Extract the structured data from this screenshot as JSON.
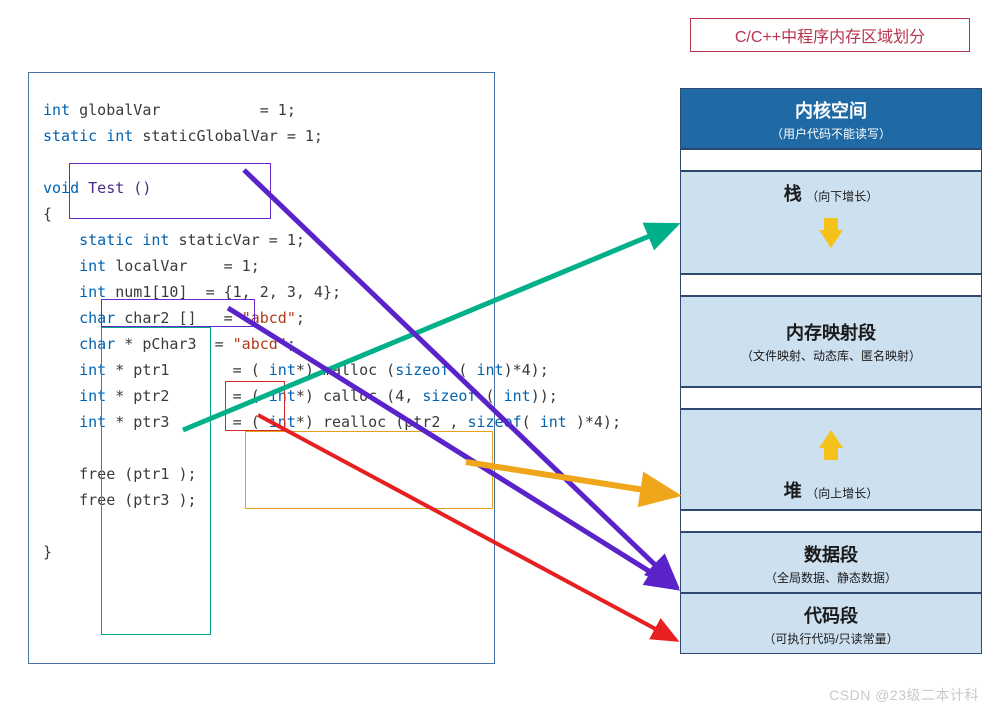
{
  "title": "C/C++中程序内存区域划分",
  "code": {
    "l1a": "int",
    "l1b": " globalVar",
    "l1c": "= 1;",
    "l2a": "static int",
    "l2b": " staticGlobalVar ",
    "l2c": "= 1;",
    "l4a": "void",
    "l4b": " Test ()",
    "l5": "{",
    "l6a": "static int",
    "l6b": " staticVar ",
    "l6c": "= 1;",
    "l7a": "int",
    "l7b": " localVar",
    "l7c": "= 1;",
    "l8a": "int",
    "l8b": " num1[10]",
    "l8c": "= {1, 2, 3, 4};",
    "l9a": "char",
    "l9b": " char2 []",
    "l9c": "= ",
    "l9d": "\"abcd\"",
    "l9e": ";",
    "l10a": "char",
    "l10b": " * pChar3",
    "l10c": "= ",
    "l10d": "\"abcd\"",
    "l10e": ";",
    "l11a": "int",
    "l11b": " * ptr1",
    "l11c": "= ( ",
    "l11d": "int",
    "l11e": "*) malloc (",
    "l11f": "sizeof",
    "l11g": " ( ",
    "l11h": "int",
    "l11i": ")*4);",
    "l12a": "int",
    "l12b": " * ptr2",
    "l12c": "= ( ",
    "l12d": "int",
    "l12e": "*) calloc (4, ",
    "l12f": "sizeof",
    "l12g": " ( ",
    "l12h": "int",
    "l12i": "));",
    "l13a": "int",
    "l13b": " * ptr3",
    "l13c": "= ( ",
    "l13d": "int",
    "l13e": "*) realloc (ptr2 , ",
    "l13f": "sizeof",
    "l13g": "( ",
    "l13h": "int",
    "l13i": " )*4);",
    "l15": "free (ptr1 );",
    "l16": "free (ptr3 );",
    "l18": "}"
  },
  "mem": {
    "kernel": {
      "t": "内核空间",
      "s": "（用户代码不能读写）"
    },
    "stack": {
      "t": "栈",
      "s": "（向下增长）"
    },
    "mmap": {
      "t": "内存映射段",
      "s": "（文件映射、动态库、匿名映射）"
    },
    "heap": {
      "t": "堆",
      "s": "（向上增长）"
    },
    "data": {
      "t": "数据段",
      "s": "（全局数据、静态数据）"
    },
    "code": {
      "t": "代码段",
      "s": "（可执行代码/只读常量）"
    }
  },
  "watermark": "CSDN @23级二本计科",
  "arrows": {
    "teal": {
      "color": "#00b089"
    },
    "purple": {
      "color": "#5a22c9"
    },
    "orange": {
      "color": "#f0a61a"
    },
    "red": {
      "color": "#e62020"
    }
  }
}
